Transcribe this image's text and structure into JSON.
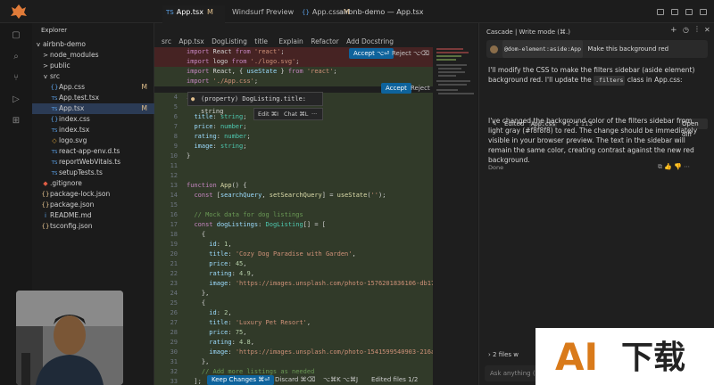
{
  "titlebar": {
    "tabs": [
      {
        "lang": "TS",
        "label": "App.tsx",
        "mod": "M",
        "active": true
      },
      {
        "lang": "",
        "label": "Windsurf Preview",
        "mod": "",
        "active": false
      },
      {
        "lang": "{}",
        "label": "App.css",
        "mod": "M",
        "active": false
      }
    ],
    "window_title": "airbnb-demo — App.tsx"
  },
  "explorer": {
    "title": "Explorer",
    "items": [
      {
        "label": "airbnb-demo",
        "icon": "v",
        "badge": ""
      },
      {
        "label": "node_modules",
        "icon": ">",
        "badge": ""
      },
      {
        "label": "public",
        "icon": ">",
        "badge": ""
      },
      {
        "label": "src",
        "icon": "v",
        "badge": ""
      },
      {
        "label": "App.css",
        "icon": "{}",
        "badge": "M"
      },
      {
        "label": "App.test.tsx",
        "icon": "TS",
        "badge": ""
      },
      {
        "label": "App.tsx",
        "icon": "TS",
        "badge": "M"
      },
      {
        "label": "index.css",
        "icon": "{}",
        "badge": ""
      },
      {
        "label": "index.tsx",
        "icon": "TS",
        "badge": ""
      },
      {
        "label": "logo.svg",
        "icon": "◇",
        "badge": ""
      },
      {
        "label": "react-app-env.d.ts",
        "icon": "TS",
        "badge": ""
      },
      {
        "label": "reportWebVitals.ts",
        "icon": "TS",
        "badge": ""
      },
      {
        "label": "setupTests.ts",
        "icon": "TS",
        "badge": ""
      },
      {
        "label": ".gitignore",
        "icon": "◆",
        "badge": ""
      },
      {
        "label": "package-lock.json",
        "icon": "{}",
        "badge": ""
      },
      {
        "label": "package.json",
        "icon": "{}",
        "badge": ""
      },
      {
        "label": "README.md",
        "icon": "i",
        "badge": ""
      },
      {
        "label": "tsconfig.json",
        "icon": "{}",
        "badge": ""
      }
    ]
  },
  "editor": {
    "breadcrumb": [
      "src",
      "App.tsx",
      "DogListing",
      "title"
    ],
    "breadcrumb_actions": [
      "Explain",
      "Refactor",
      "Add Docstring"
    ],
    "accept_label": "Accept ⌥⏎",
    "reject_label": "Reject ⌥⌫",
    "accept2_label": "Accept",
    "reject2_label": "Reject",
    "tooltip": "(property) DogListing.title: string",
    "tooltip_actions": [
      "Edit ⌘I",
      "Chat ⌘L",
      "···"
    ],
    "keep_label": "Keep Changes ⌘⏎",
    "discard_label": "Discard ⌘⌫",
    "nav_label": "⌥⌘K ⌥⌘J",
    "files_label": "Edited files 1/2"
  },
  "cascade": {
    "header": "Cascade | Write mode (⌘.)",
    "user_chip": "@dom-element:aside:App",
    "user_msg": "Make this background red",
    "reply1": "I'll modify the CSS to make the filters sidebar (aside element) background red. I'll update the",
    "reply1_chip": ".filters",
    "reply1_tail": "class in App.css:",
    "edited_label": "Edited",
    "edited_file": "App.css",
    "edited_diff": "+1 -1 113",
    "open_diff": "Open diff",
    "reply2": "I've changed the background color of the filters sidebar from light gray (#f8f8f8) to red. The change should be immediately visible in your browser preview. The text in the sidebar will remain the same color, creating contrast against the new red background.",
    "status": "Done",
    "files_changed": "2 files w",
    "input_placeholder": "Ask anything (⌘L)"
  },
  "watermark": {
    "ai": "AI",
    "cn": "下载"
  },
  "colors": {
    "accent": "#0e639c",
    "modified": "#e2c08d",
    "watermark_orange": "#d97a1a"
  }
}
